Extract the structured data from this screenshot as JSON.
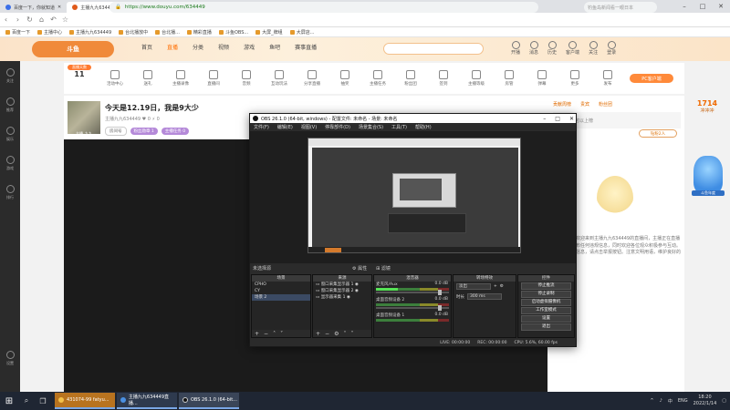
{
  "browser": {
    "tabs": [
      {
        "label": "百度一下，你就知道",
        "active": false
      },
      {
        "label": "主播九九634449直播_穿越...",
        "active": true
      }
    ],
    "new_tab": "+",
    "window_controls": [
      "–",
      "□",
      "✕"
    ],
    "url": "https://www.douyu.com/634449",
    "search_placeholder": "钓鱼岛新闻看一眼日本",
    "bookmarks": [
      "百度一下",
      "主播中心",
      "主播九九634449",
      "台北播放中",
      "台北播...",
      "精彩直播",
      "斗鱼OBS...",
      "大屏_牌组",
      "大屏店..."
    ]
  },
  "site": {
    "logo": "斗鱼",
    "nav": [
      "首页",
      "直播",
      "分类",
      "视频",
      "游戏",
      "鱼吧",
      "赛事直播"
    ],
    "active_nav": "直播",
    "header_icons": [
      "开播",
      "消息",
      "历史",
      "客户端",
      "关注",
      "登录"
    ],
    "left_rail": [
      "关注",
      "推荐",
      "娱乐",
      "游戏",
      "排行",
      "设置"
    ],
    "day_tag": "直播天数",
    "day_number": "11",
    "toolbar_items": [
      "活动中心",
      "送礼",
      "主播录像",
      "直播间",
      "音频",
      "互动玩法",
      "分享直播",
      "抽奖",
      "主播任务",
      "粉丝团",
      "签到",
      "主播等级",
      "房管",
      "弹幕",
      "更多",
      "发布",
      "主播工具"
    ],
    "pc_link": "PC客户端",
    "room": {
      "avatar_name": "主播_九九",
      "title": "今天是12.19日，我是9大少",
      "meta": "主播九九634449 ♥ 0   ⚡ 0",
      "badges": [
        "房间号",
        "粉丝勋章 1",
        "主播任务 0"
      ]
    },
    "right_panel": {
      "rank_tabs": [
        "贡献周榜",
        "贵宾",
        "粉丝团"
      ],
      "rank_ad": "开通贵族可以上榜",
      "diamond_btn": "钻粉2人",
      "chat_text": "系统提示：欢迎来到主播九九634449的直播间，主播正在直播中，禁止发布任何违规信息，同时欢迎各位观众积极参与互动。如发现违规信息，请点击举报按钮。注意文明用语，维护良好的直播环境。"
    },
    "promo": {
      "title": "1714",
      "subtitle": "冲冲冲",
      "jar_label": "斗鱼年度"
    }
  },
  "obs": {
    "title": "OBS 26.1.0 (64-bit, windows) - 配置文件: 未命名 - 场景: 未命名",
    "menu": [
      "文件(F)",
      "编辑(E)",
      "视图(V)",
      "停靠部件(D)",
      "场景集合(S)",
      "工具(T)",
      "帮助(H)"
    ],
    "scene_label": "未选择源",
    "props": [
      "⚙ 属性",
      "⊞ 滤镜"
    ],
    "docks": {
      "scenes": {
        "title": "场景",
        "items": [
          "CPHO",
          "CY",
          "场景 2"
        ],
        "selected": 2
      },
      "sources": {
        "title": "来源",
        "items": [
          "窗口采集显示器 1",
          "窗口采集显示器 2",
          "显示器采集 1"
        ]
      },
      "mixer": {
        "title": "混音器",
        "channels": [
          {
            "name": "麦克风/Aux",
            "db": "0.0 dB"
          },
          {
            "name": "桌面音频设备 2",
            "db": "0.0 dB"
          },
          {
            "name": "桌面音频设备 1",
            "db": "0.0 dB"
          }
        ]
      },
      "transitions": {
        "title": "转场特效",
        "type": "淡出",
        "duration_label": "时长",
        "duration": "300 ms"
      },
      "controls": {
        "title": "控件",
        "buttons": [
          "停止推流",
          "停止录制",
          "启动虚拟摄像机",
          "工作室模式",
          "设置",
          "退出"
        ]
      }
    },
    "status": [
      "LIVE: 00:00:00",
      "REC: 00:00:00",
      "CPU: 5.6%, 60.00 fps"
    ]
  },
  "taskbar": {
    "start_icon": "⊞",
    "apps": [
      {
        "label": "431074-99 fatyu...",
        "color": "#d9822b"
      },
      {
        "label": "主播九九634449直播...",
        "color": "#4a90e2"
      },
      {
        "label": "OBS 26.1.0 (64-bit...",
        "color": "#333333"
      }
    ],
    "tray": [
      "^",
      "♪",
      "中",
      "ENG"
    ],
    "time": "18:20",
    "date": "2022/1/14"
  }
}
